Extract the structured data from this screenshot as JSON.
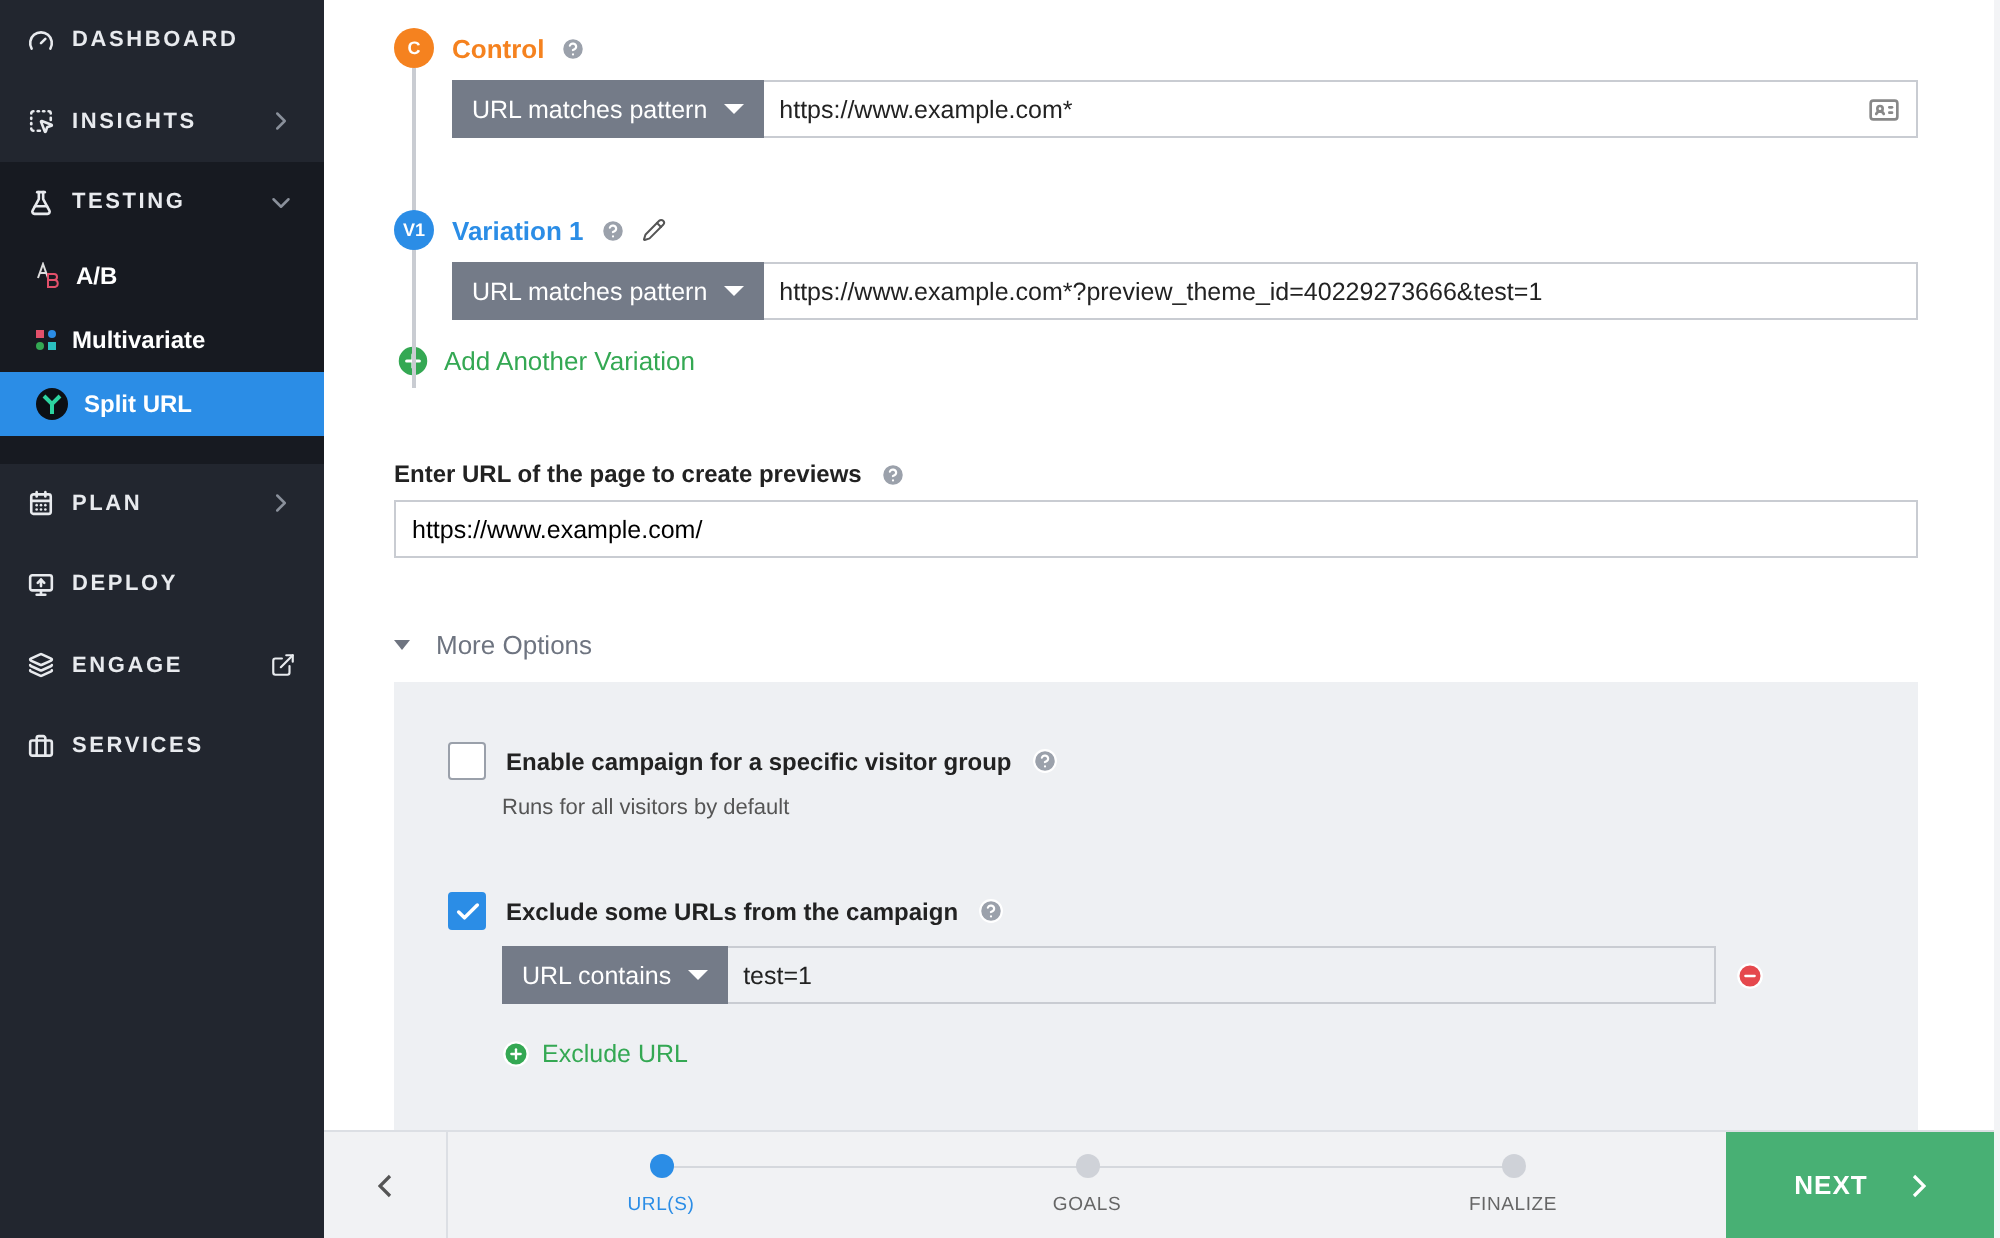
{
  "sidebar": {
    "items": [
      {
        "label": "DASHBOARD",
        "kind": "link"
      },
      {
        "label": "INSIGHTS",
        "kind": "menu",
        "expanded": false
      },
      {
        "label": "TESTING",
        "kind": "menu",
        "expanded": true,
        "children": [
          {
            "label": "A/B",
            "selected": false
          },
          {
            "label": "Multivariate",
            "selected": false
          },
          {
            "label": "Split URL",
            "selected": true
          }
        ]
      },
      {
        "label": "PLAN",
        "kind": "menu",
        "expanded": false
      },
      {
        "label": "DEPLOY",
        "kind": "link"
      },
      {
        "label": "ENGAGE",
        "kind": "external"
      },
      {
        "label": "SERVICES",
        "kind": "link"
      }
    ]
  },
  "variations": [
    {
      "badge": "C",
      "label": "Control",
      "color": "#f5821f",
      "match": "URL matches pattern",
      "value": "https://www.example.com*",
      "editable": false,
      "picker": true
    },
    {
      "badge": "V1",
      "label": "Variation 1",
      "color": "#2b8de6",
      "match": "URL matches pattern",
      "value": "https://www.example.com*?preview_theme_id=40229273666&test=1",
      "editable": true,
      "picker": false
    }
  ],
  "add_variation": "Add Another Variation",
  "preview_url": {
    "label": "Enter URL of the page to create previews",
    "value": "https://www.example.com/"
  },
  "more_options": {
    "label": "More Options",
    "expanded": true,
    "options": [
      {
        "label": "Enable campaign for a specific visitor group",
        "checked": false,
        "hint": "Runs for all visitors by default"
      },
      {
        "label": "Exclude some URLs from the campaign",
        "checked": true,
        "rules": [
          {
            "match": "URL contains",
            "value": "test=1"
          }
        ],
        "add": "Exclude URL"
      }
    ]
  },
  "footer": {
    "steps": [
      {
        "label": "URL(S)",
        "selected": true
      },
      {
        "label": "GOALS",
        "selected": false
      },
      {
        "label": "FINALIZE",
        "selected": false
      }
    ],
    "next": "NEXT"
  }
}
